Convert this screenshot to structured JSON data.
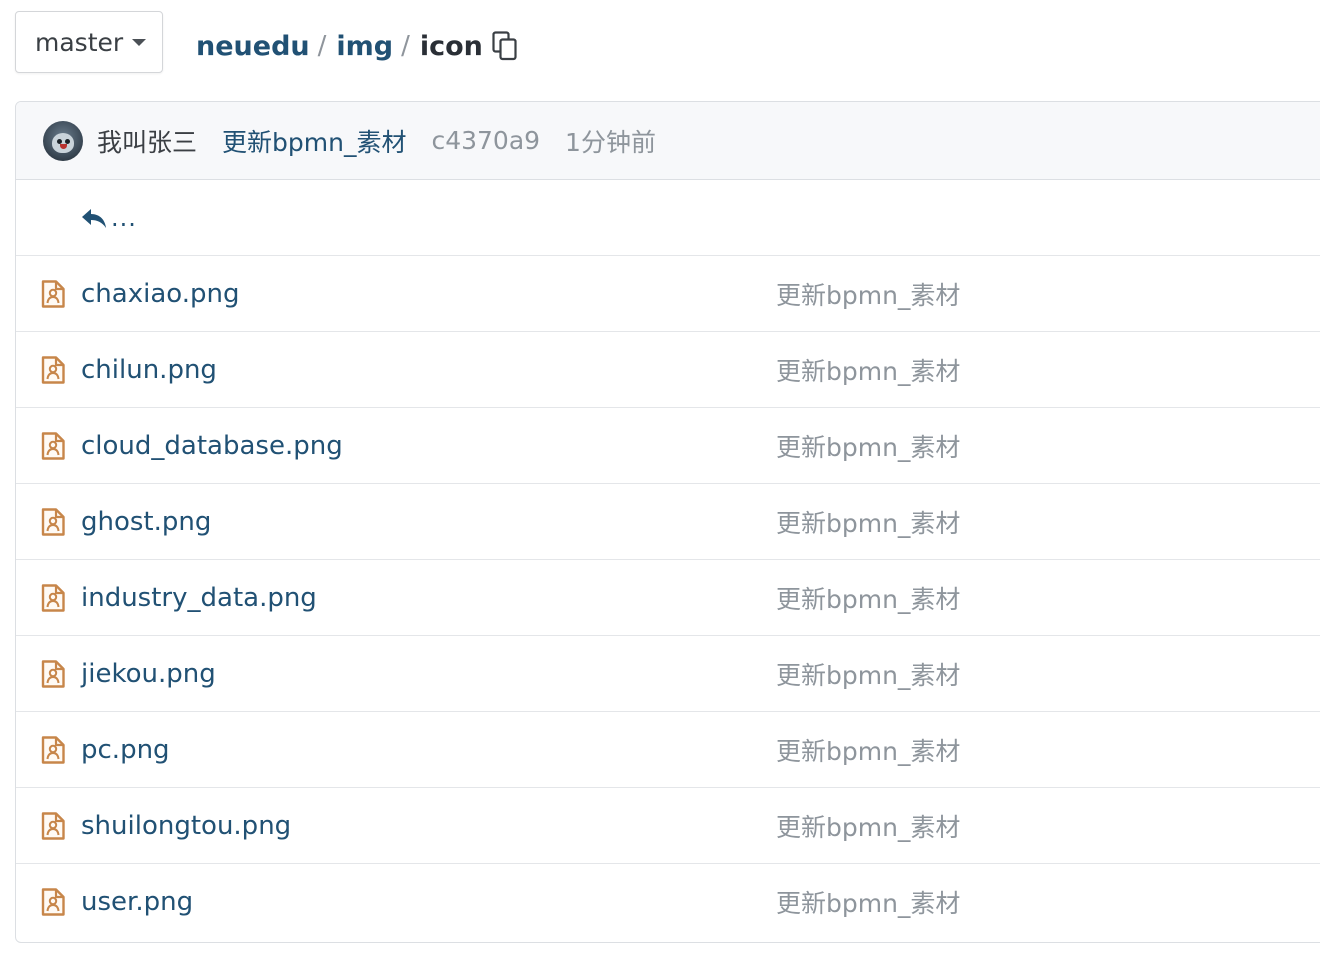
{
  "branch": {
    "label": "master"
  },
  "breadcrumb": {
    "items": [
      "neuedu",
      "img"
    ],
    "separator": "/",
    "current": "icon"
  },
  "commit": {
    "author": "我叫张三",
    "message": "更新bpmn_素材",
    "sha": "c4370a9",
    "time": "1分钟前"
  },
  "parent_link": {
    "label": "..."
  },
  "files": [
    {
      "name": "chaxiao.png",
      "commit": "更新bpmn_素材"
    },
    {
      "name": "chilun.png",
      "commit": "更新bpmn_素材"
    },
    {
      "name": "cloud_database.png",
      "commit": "更新bpmn_素材"
    },
    {
      "name": "ghost.png",
      "commit": "更新bpmn_素材"
    },
    {
      "name": "industry_data.png",
      "commit": "更新bpmn_素材"
    },
    {
      "name": "jiekou.png",
      "commit": "更新bpmn_素材"
    },
    {
      "name": "pc.png",
      "commit": "更新bpmn_素材"
    },
    {
      "name": "shuilongtou.png",
      "commit": "更新bpmn_素材"
    },
    {
      "name": "user.png",
      "commit": "更新bpmn_素材"
    }
  ],
  "colors": {
    "link": "#215174",
    "muted": "#8e959c",
    "file_icon": "#c7864a"
  },
  "icons": {
    "copy": "copy-icon",
    "up": "reply-arrow-icon",
    "file": "image-file-icon",
    "branch_caret": "caret-down-icon"
  }
}
